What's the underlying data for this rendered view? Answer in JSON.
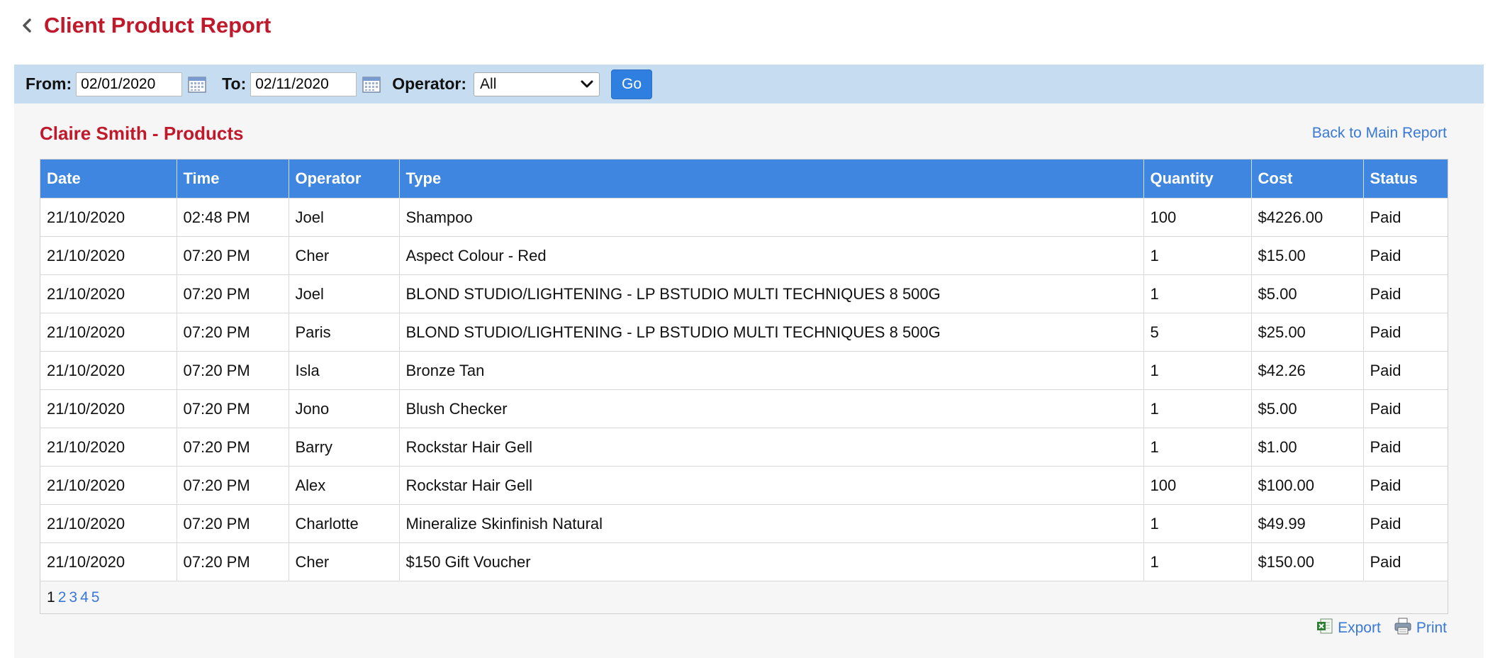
{
  "header": {
    "title": "Client Product Report"
  },
  "filters": {
    "from_label": "From:",
    "from_value": "02/01/2020",
    "to_label": "To:",
    "to_value": "02/11/2020",
    "operator_label": "Operator:",
    "operator_value": "All",
    "go_label": "Go"
  },
  "section": {
    "title": "Claire Smith - Products",
    "back_link": "Back to Main Report"
  },
  "table": {
    "columns": [
      "Date",
      "Time",
      "Operator",
      "Type",
      "Quantity",
      "Cost",
      "Status"
    ],
    "rows": [
      [
        "21/10/2020",
        "02:48 PM",
        "Joel",
        "Shampoo",
        "100",
        "$4226.00",
        "Paid"
      ],
      [
        "21/10/2020",
        "07:20 PM",
        "Cher",
        "Aspect Colour - Red",
        "1",
        "$15.00",
        "Paid"
      ],
      [
        "21/10/2020",
        "07:20 PM",
        "Joel",
        "BLOND STUDIO/LIGHTENING - LP BSTUDIO MULTI TECHNIQUES 8 500G",
        "1",
        "$5.00",
        "Paid"
      ],
      [
        "21/10/2020",
        "07:20 PM",
        "Paris",
        "BLOND STUDIO/LIGHTENING - LP BSTUDIO MULTI TECHNIQUES 8 500G",
        "5",
        "$25.00",
        "Paid"
      ],
      [
        "21/10/2020",
        "07:20 PM",
        "Isla",
        "Bronze Tan",
        "1",
        "$42.26",
        "Paid"
      ],
      [
        "21/10/2020",
        "07:20 PM",
        "Jono",
        "Blush Checker",
        "1",
        "$5.00",
        "Paid"
      ],
      [
        "21/10/2020",
        "07:20 PM",
        "Barry",
        "Rockstar Hair Gell",
        "1",
        "$1.00",
        "Paid"
      ],
      [
        "21/10/2020",
        "07:20 PM",
        "Alex",
        "Rockstar Hair Gell",
        "100",
        "$100.00",
        "Paid"
      ],
      [
        "21/10/2020",
        "07:20 PM",
        "Charlotte",
        "Mineralize Skinfinish Natural",
        "1",
        "$49.99",
        "Paid"
      ],
      [
        "21/10/2020",
        "07:20 PM",
        "Cher",
        "$150 Gift Voucher",
        "1",
        "$150.00",
        "Paid"
      ]
    ]
  },
  "pagination": {
    "current": "1",
    "pages": [
      "2",
      "3",
      "4",
      "5"
    ]
  },
  "actions": {
    "export_label": "Export",
    "print_label": "Print"
  },
  "colors": {
    "title_red": "#c0192c",
    "header_blue": "#3f86e0",
    "filter_bar": "#c6ddf1",
    "link_blue": "#3a78d6"
  }
}
